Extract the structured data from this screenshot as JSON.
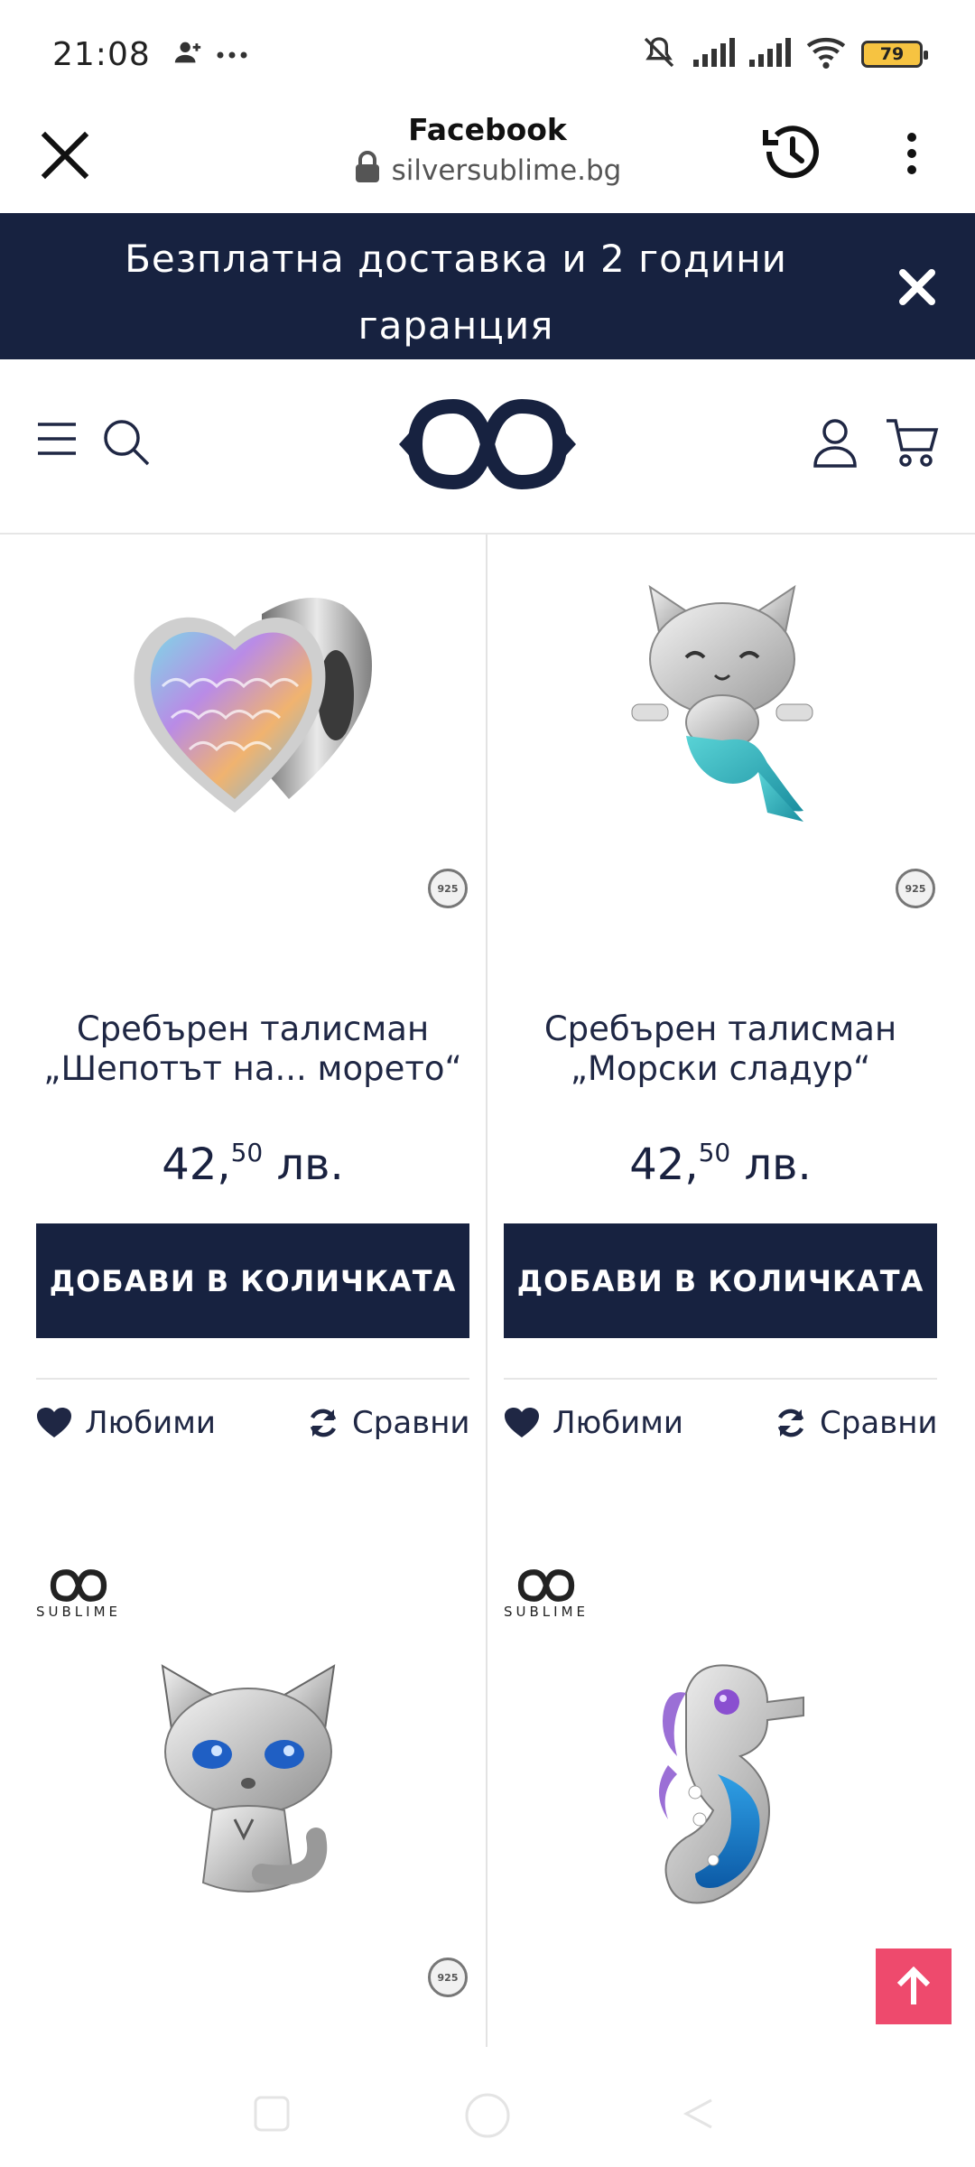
{
  "status_bar": {
    "time": "21:08",
    "battery": "79",
    "icons": [
      "person-add-icon",
      "more-dots-icon",
      "mute-icon",
      "signal-icon",
      "signal-icon",
      "wifi-icon",
      "battery-icon"
    ]
  },
  "browser": {
    "title": "Facebook",
    "url": "silversublime.bg",
    "icons": [
      "close-icon",
      "lock-icon",
      "history-icon",
      "more-vert-icon"
    ]
  },
  "announcement": {
    "text": "Безплатна доставка и 2 години гаранция"
  },
  "header": {
    "icons": [
      "menu-icon",
      "search-icon",
      "logo-infinity-icon",
      "account-icon",
      "cart-icon"
    ]
  },
  "products": [
    {
      "title": "Сребърен талисман „Шепотът на... морето“",
      "price_main": "42,",
      "price_cents": "50",
      "currency": "лв.",
      "add_label": "ДОБАВИ В КОЛИЧКАТА",
      "fav_label": "Любими",
      "compare_label": "Сравни"
    },
    {
      "title": "Сребърен талисман „Морски сладур“",
      "price_main": "42,",
      "price_cents": "50",
      "currency": "лв.",
      "add_label": "ДОБАВИ В КОЛИЧКАТА",
      "fav_label": "Любими",
      "compare_label": "Сравни"
    },
    {
      "brand": "SUBLIME"
    },
    {
      "brand": "SUBLIME"
    }
  ],
  "badge": {
    "text": "925"
  },
  "colors": {
    "navy": "#172240",
    "scroll_top": "#ee4a6d"
  }
}
